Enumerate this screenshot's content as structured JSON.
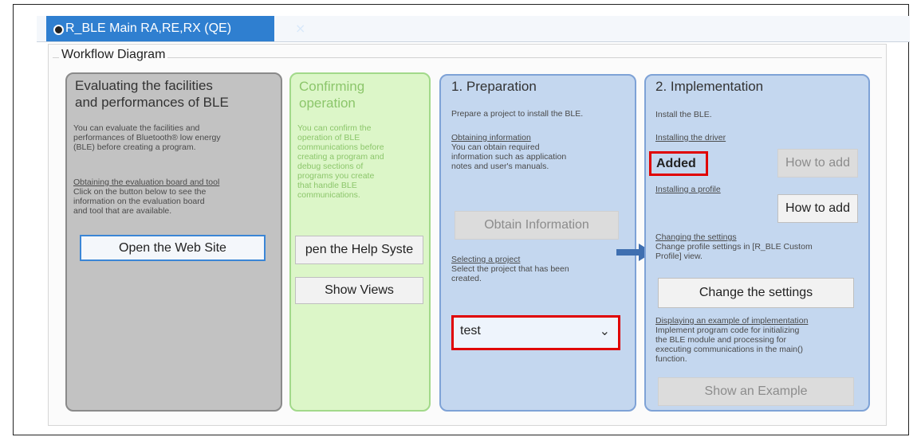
{
  "tab": {
    "title": "R_BLE Main RA,RE,RX (QE)",
    "close_glyph": "×"
  },
  "legend": "Workflow Diagram",
  "card1": {
    "title_line1": "Evaluating the facilities",
    "title_line2": "and performances of BLE",
    "body": [
      "You can evaluate the facilities and",
      "performances of Bluetooth® low energy",
      "(BLE) before creating a program."
    ],
    "link": "Obtaining the evaluation board and tool",
    "link_body": [
      "Click on the button below to see the",
      "information on the evaluation board",
      "and tool that are available."
    ],
    "button": "Open the Web Site"
  },
  "card2": {
    "title_line1": "Confirming",
    "title_line2": "operation",
    "body": [
      "You can confirm the",
      "operation of BLE",
      "communications before",
      "creating a program and",
      "debug sections of",
      "programs you create",
      "that handle BLE",
      "communications."
    ],
    "help_button": "pen the Help Syste",
    "views_button": "Show Views"
  },
  "card3": {
    "title": "1. Preparation",
    "intro": "Prepare a project to install the BLE.",
    "link1": "Obtaining information",
    "link1_body": [
      "You can obtain required",
      "information such as application",
      "notes and user's manuals."
    ],
    "obtain_button": "Obtain Information",
    "link2": "Selecting a project",
    "link2_body": [
      "Select the project that has been",
      "created."
    ],
    "select_value": "test",
    "chevron": "⌄"
  },
  "card4": {
    "title": "2. Implementation",
    "intro": "Install the BLE.",
    "link1": "Installing the driver",
    "added_label": "Added",
    "howto1": "How to add",
    "link2": "Installing a profile",
    "howto2": "How to add",
    "link3": "Changing the settings",
    "link3_body": [
      "Change profile settings in [R_BLE Custom",
      "Profile] view."
    ],
    "change_button": "Change the settings",
    "link4": "Displaying an example of implementation",
    "link4_body": [
      "Implement program code for initializing",
      "the BLE module and processing for",
      "executing communications in the main()",
      "function."
    ],
    "example_button": "Show an Example"
  },
  "colors": {
    "tab": "#2f7fd0",
    "highlight": "#e00000",
    "arrow": "#3f6fb0"
  }
}
